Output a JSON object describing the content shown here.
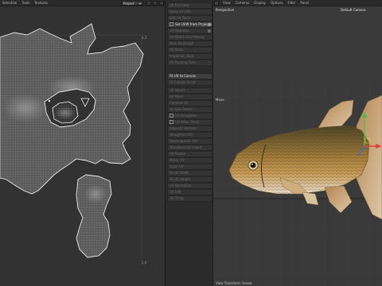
{
  "uv_editor": {
    "menu": [
      "Selection",
      "Tools",
      "Textures"
    ],
    "dropdown_value": "Project",
    "corner_top_right": "1,1",
    "corner_bottom_right": "1,0"
  },
  "command_panel": {
    "group1": [
      "UV Full Step",
      "Relax UV Edit",
      "Edit UV Tools",
      "Set UVW from Projection",
      "UV Optimize",
      "UV Match Grid Remap",
      "Pack Rectangle",
      "UV Relax",
      "Projection Tools",
      "UV Packing Tools"
    ],
    "group2": [
      "Fit UV to Canvas",
      "Fit Canvas to UV"
    ],
    "group3": [
      "UV Island",
      "UV Shell",
      "Connect UV",
      "UV Sew Select",
      "UV Straighten",
      "UV Relax Stack",
      "Align UV Vertices",
      "Straighten UVs",
      "Rectangulate UVs",
      "Transform UV Island",
      "UV Rotate",
      "Mirror UV",
      "Scale UV",
      "Fit UV Width",
      "Fit UV Height",
      "UV Normalize",
      "UV Info",
      "UV Tiling"
    ]
  },
  "viewport": {
    "menu": [
      "View",
      "Cameras",
      "Display",
      "Options",
      "Filter",
      "Panel"
    ],
    "projection_label": "Perspective",
    "camera_label": "Default Camera",
    "side_label": "Move",
    "footer_label": "View Transform: Scene"
  },
  "colors": {
    "uv_background": "#323232",
    "viewport_background": "#3a3a3a",
    "panel_background": "#2b2b2b",
    "uv_wire": "#e8e8e8",
    "active_text": "#e2e2e2",
    "axis_x": "#e04040",
    "axis_y": "#3cc44a",
    "axis_z": "#3a6ae0"
  },
  "icons": [
    "menu-icon",
    "gear-icon",
    "checkbox-icon"
  ]
}
